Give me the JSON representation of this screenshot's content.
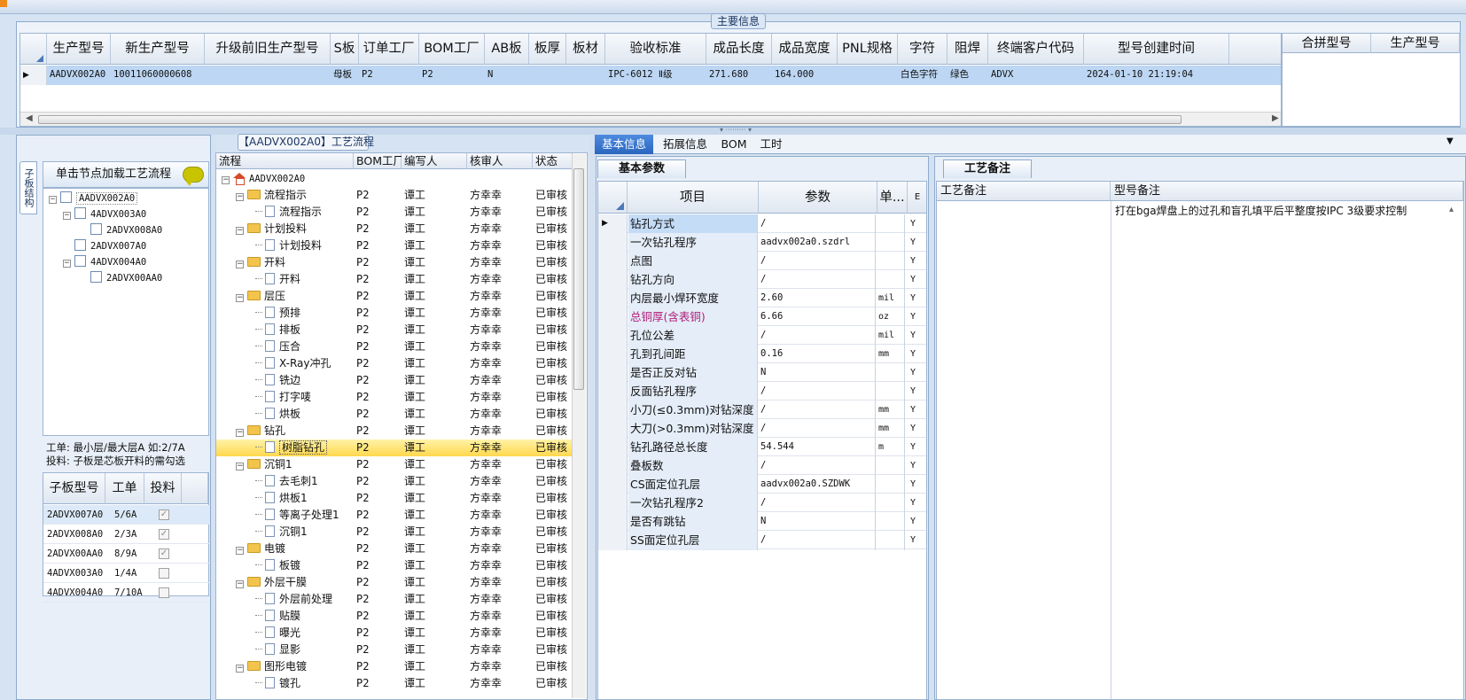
{
  "main_info": {
    "group_title": "主要信息",
    "columns": [
      "生产型号",
      "新生产型号",
      "升级前旧生产型号",
      "S板",
      "订单工厂",
      "BOM工厂",
      "AB板",
      "板厚",
      "板材",
      "验收标准",
      "成品长度",
      "成品宽度",
      "PNL规格",
      "字符",
      "阻焊",
      "终端客户代码",
      "型号创建时间"
    ],
    "row": [
      "AADVX002A0",
      "10011060000608",
      "",
      "母板",
      "P2",
      "P2",
      "N",
      "",
      "",
      "IPC-6012 Ⅱ级",
      "271.680",
      "164.000",
      "",
      "白色字符",
      "绿色",
      "ADVX",
      "2024-01-10 21:19:04"
    ],
    "merge_columns": [
      "合拼型号",
      "生产型号"
    ]
  },
  "left_panel": {
    "vertical_tab": "子板结构",
    "load_hint": "单击节点加载工艺流程",
    "tree": [
      {
        "label": "AADVX002A0",
        "level": 0
      },
      {
        "label": "4ADVX003A0",
        "level": 1
      },
      {
        "label": "2ADVX008A0",
        "level": 2
      },
      {
        "label": "2ADVX007A0",
        "level": 1
      },
      {
        "label": "4ADVX004A0",
        "level": 1
      },
      {
        "label": "2ADVX00AA0",
        "level": 2
      }
    ],
    "note_line1": "工单: 最小层/最大层A 如:2/7A",
    "note_line2": "投料: 子板是芯板开料的需勾选",
    "sub_columns": [
      "子板型号",
      "工单",
      "投料"
    ],
    "sub_rows": [
      {
        "model": "2ADVX007A0",
        "order": "5/6A",
        "feed": true
      },
      {
        "model": "2ADVX008A0",
        "order": "2/3A",
        "feed": true
      },
      {
        "model": "2ADVX00AA0",
        "order": "8/9A",
        "feed": true
      },
      {
        "model": "4ADVX003A0",
        "order": "1/4A",
        "feed": false
      },
      {
        "model": "4ADVX004A0",
        "order": "7/10A",
        "feed": false
      }
    ]
  },
  "process": {
    "title": "【AADVX002A0】工艺流程",
    "columns": [
      "流程",
      "BOM工厂",
      "编写人",
      "核审人",
      "状态"
    ],
    "rows": [
      {
        "name": "AADVX002A0",
        "type": "root",
        "bom": "",
        "author": "",
        "reviewer": "",
        "status": ""
      },
      {
        "name": "流程指示",
        "type": "folder",
        "bom": "P2",
        "author": "谭工",
        "reviewer": "方幸幸",
        "status": "已审核"
      },
      {
        "name": "流程指示",
        "type": "doc",
        "bom": "P2",
        "author": "谭工",
        "reviewer": "方幸幸",
        "status": "已审核"
      },
      {
        "name": "计划投料",
        "type": "folder",
        "bom": "P2",
        "author": "谭工",
        "reviewer": "方幸幸",
        "status": "已审核"
      },
      {
        "name": "计划投料",
        "type": "doc",
        "bom": "P2",
        "author": "谭工",
        "reviewer": "方幸幸",
        "status": "已审核"
      },
      {
        "name": "开料",
        "type": "folder",
        "bom": "P2",
        "author": "谭工",
        "reviewer": "方幸幸",
        "status": "已审核"
      },
      {
        "name": "开料",
        "type": "doc",
        "bom": "P2",
        "author": "谭工",
        "reviewer": "方幸幸",
        "status": "已审核"
      },
      {
        "name": "层压",
        "type": "folder",
        "bom": "P2",
        "author": "谭工",
        "reviewer": "方幸幸",
        "status": "已审核"
      },
      {
        "name": "预排",
        "type": "doc",
        "bom": "P2",
        "author": "谭工",
        "reviewer": "方幸幸",
        "status": "已审核"
      },
      {
        "name": "排板",
        "type": "doc",
        "bom": "P2",
        "author": "谭工",
        "reviewer": "方幸幸",
        "status": "已审核"
      },
      {
        "name": "压合",
        "type": "doc",
        "bom": "P2",
        "author": "谭工",
        "reviewer": "方幸幸",
        "status": "已审核"
      },
      {
        "name": "X-Ray冲孔",
        "type": "doc",
        "bom": "P2",
        "author": "谭工",
        "reviewer": "方幸幸",
        "status": "已审核"
      },
      {
        "name": "铣边",
        "type": "doc",
        "bom": "P2",
        "author": "谭工",
        "reviewer": "方幸幸",
        "status": "已审核"
      },
      {
        "name": "打字唛",
        "type": "doc",
        "bom": "P2",
        "author": "谭工",
        "reviewer": "方幸幸",
        "status": "已审核"
      },
      {
        "name": "烘板",
        "type": "doc",
        "bom": "P2",
        "author": "谭工",
        "reviewer": "方幸幸",
        "status": "已审核"
      },
      {
        "name": "钻孔",
        "type": "folder",
        "bom": "P2",
        "author": "谭工",
        "reviewer": "方幸幸",
        "status": "已审核"
      },
      {
        "name": "树脂钻孔",
        "type": "doc",
        "bom": "P2",
        "author": "谭工",
        "reviewer": "方幸幸",
        "status": "已审核",
        "selected": true
      },
      {
        "name": "沉铜1",
        "type": "folder",
        "bom": "P2",
        "author": "谭工",
        "reviewer": "方幸幸",
        "status": "已审核"
      },
      {
        "name": "去毛刺1",
        "type": "doc",
        "bom": "P2",
        "author": "谭工",
        "reviewer": "方幸幸",
        "status": "已审核"
      },
      {
        "name": "烘板1",
        "type": "doc",
        "bom": "P2",
        "author": "谭工",
        "reviewer": "方幸幸",
        "status": "已审核"
      },
      {
        "name": "等离子处理1",
        "type": "doc",
        "bom": "P2",
        "author": "谭工",
        "reviewer": "方幸幸",
        "status": "已审核"
      },
      {
        "name": "沉铜1",
        "type": "doc",
        "bom": "P2",
        "author": "谭工",
        "reviewer": "方幸幸",
        "status": "已审核"
      },
      {
        "name": "电镀",
        "type": "folder",
        "bom": "P2",
        "author": "谭工",
        "reviewer": "方幸幸",
        "status": "已审核"
      },
      {
        "name": "板镀",
        "type": "doc",
        "bom": "P2",
        "author": "谭工",
        "reviewer": "方幸幸",
        "status": "已审核"
      },
      {
        "name": "外层干膜",
        "type": "folder",
        "bom": "P2",
        "author": "谭工",
        "reviewer": "方幸幸",
        "status": "已审核"
      },
      {
        "name": "外层前处理",
        "type": "doc",
        "bom": "P2",
        "author": "谭工",
        "reviewer": "方幸幸",
        "status": "已审核"
      },
      {
        "name": "贴膜",
        "type": "doc",
        "bom": "P2",
        "author": "谭工",
        "reviewer": "方幸幸",
        "status": "已审核"
      },
      {
        "name": "曝光",
        "type": "doc",
        "bom": "P2",
        "author": "谭工",
        "reviewer": "方幸幸",
        "status": "已审核"
      },
      {
        "name": "显影",
        "type": "doc",
        "bom": "P2",
        "author": "谭工",
        "reviewer": "方幸幸",
        "status": "已审核"
      },
      {
        "name": "图形电镀",
        "type": "folder",
        "bom": "P2",
        "author": "谭工",
        "reviewer": "方幸幸",
        "status": "已审核"
      },
      {
        "name": "镀孔",
        "type": "doc",
        "bom": "P2",
        "author": "谭工",
        "reviewer": "方幸幸",
        "status": "已审核"
      }
    ]
  },
  "tabs": [
    "基本信息",
    "拓展信息",
    "BOM",
    "工时"
  ],
  "basic_params": {
    "tab_title": "基本参数",
    "columns": [
      "项目",
      "参数",
      "单...",
      "E"
    ],
    "rows": [
      {
        "item": "钻孔方式",
        "param": "/",
        "unit": "",
        "flag": "Y",
        "current": true
      },
      {
        "item": "一次钻孔程序",
        "param": "aadvx002a0.szdrl",
        "unit": "",
        "flag": "Y"
      },
      {
        "item": "点图",
        "param": "/",
        "unit": "",
        "flag": "Y"
      },
      {
        "item": "钻孔方向",
        "param": "/",
        "unit": "",
        "flag": "Y"
      },
      {
        "item": "内层最小焊环宽度",
        "param": "2.60",
        "unit": "mil",
        "flag": "Y"
      },
      {
        "item": "总铜厚(含表铜)",
        "param": "6.66",
        "unit": "oz",
        "flag": "Y",
        "pink": true
      },
      {
        "item": "孔位公差",
        "param": "/",
        "unit": "mil",
        "flag": "Y"
      },
      {
        "item": "孔到孔间距",
        "param": "0.16",
        "unit": "mm",
        "flag": "Y"
      },
      {
        "item": "是否正反对钻",
        "param": "N",
        "unit": "",
        "flag": "Y"
      },
      {
        "item": "反面钻孔程序",
        "param": "/",
        "unit": "",
        "flag": "Y"
      },
      {
        "item": "小刀(≤0.3mm)对钻深度",
        "param": "/",
        "unit": "mm",
        "flag": "Y"
      },
      {
        "item": "大刀(>0.3mm)对钻深度",
        "param": "/",
        "unit": "mm",
        "flag": "Y"
      },
      {
        "item": "钻孔路径总长度",
        "param": "54.544",
        "unit": "m",
        "flag": "Y"
      },
      {
        "item": "叠板数",
        "param": "/",
        "unit": "",
        "flag": "Y"
      },
      {
        "item": "CS面定位孔层",
        "param": "aadvx002a0.SZDWK",
        "unit": "",
        "flag": "Y"
      },
      {
        "item": "一次钻孔程序2",
        "param": "/",
        "unit": "",
        "flag": "Y"
      },
      {
        "item": "是否有跳钻",
        "param": "N",
        "unit": "",
        "flag": "Y"
      },
      {
        "item": "SS面定位孔层",
        "param": "/",
        "unit": "",
        "flag": "Y"
      }
    ]
  },
  "remarks": {
    "tab_title": "工艺备注",
    "col_process": "工艺备注",
    "col_model": "型号备注",
    "model_note": "打在bga焊盘上的过孔和盲孔填平后平整度按IPC 3级要求控制"
  },
  "colors": {
    "selection_blue": "#bcd6f3",
    "selected_row_yellow": "#ffd84d",
    "active_tab": "#2b66be",
    "pink_item": "#b0207a"
  }
}
